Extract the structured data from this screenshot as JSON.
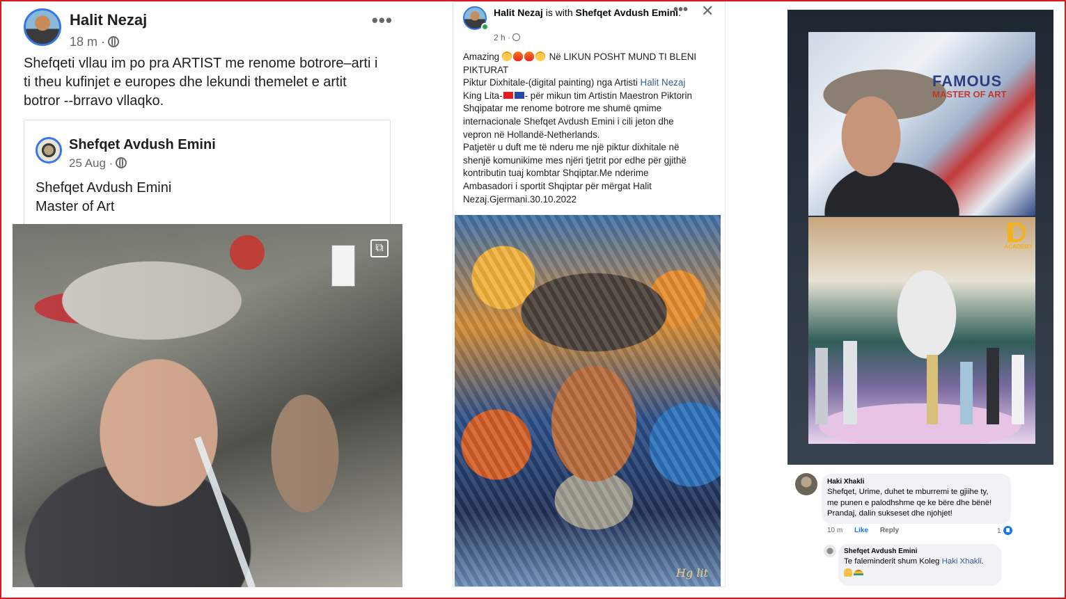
{
  "panel1": {
    "author": "Halit Nezaj",
    "meta": "18 m ·",
    "menu": "•••",
    "post_lines": [
      "Shefqeti vllau im po pra ARTIST me renome botrore–arti i",
      "ti theu kufinjet e europes dhe lekundi themelet e artit",
      "botror --brravo vllaqko."
    ],
    "shared": {
      "author": "Shefqet Avdush Emini",
      "meta": "25 Aug ·",
      "lines": [
        "Shefqet Avdush Emini",
        "Master of Art"
      ]
    }
  },
  "panel2": {
    "author": "Halit Nezaj",
    "with_word": " is with ",
    "tagged": "Shefqet Avdush Emini",
    "tagged_end": ".",
    "meta": "2 h ·",
    "menu": "•••",
    "close": "✕",
    "line1_pre": "Amazing",
    "line1_post": " Në LIKUN POSHT MUND TI BLENI",
    "line2": "PIKTURAT",
    "line3_pre": "Piktur  Dixhitale-(digital painting) nga Artisti  ",
    "line3_link": "Halit Nezaj",
    "line4_pre": "King Lita-",
    "line4_post": "- për mikun tim Artistin Maestron Piktorin",
    "body_lines": [
      "Shqipatar me renome botrore me shumë qmime",
      "internacionale Shefqet Avdush Emini i cili jeton dhe",
      "vepron në Hollandë-Netherlands.",
      "Patjetër u duft me të nderu me një piktur dixhitale në",
      "shenjë komunikime mes  njëri tjetrit por edhe për gjithë",
      "kontributin tuaj kombtar Shqiptar.Me nderime",
      "Ambasadori i sportit Shqiptar për mërgat Halit",
      "Nezaj.Gjermani.30.10.2022"
    ],
    "signature": "Hg lit"
  },
  "panel3": {
    "title_big": "FAMOUS",
    "title_small": "MASTER OF ART",
    "tv_logo": "D",
    "tv_logo_text": "ACADEMY",
    "comment": {
      "author": "Haki Xhakli",
      "lines": [
        "Shefqet, Urime, duhet te mburremi te gjiihe ty,",
        "me punen e palodhshme qe ke bëre dhe bënë!",
        "Prandaj, dalin sukseset dhe njohjet!"
      ],
      "time": "10 m",
      "like": "Like",
      "reply": "Reply",
      "count": "1"
    },
    "reply": {
      "author": "Shefqet Avdush Emini",
      "text_pre": "Te faleminderit shum Koleg ",
      "text_link": "Haki Xhakli",
      "text_end": "."
    }
  },
  "colors": {
    "border": "#e0141b",
    "link": "#385898",
    "fb_blue": "#1877f2"
  }
}
